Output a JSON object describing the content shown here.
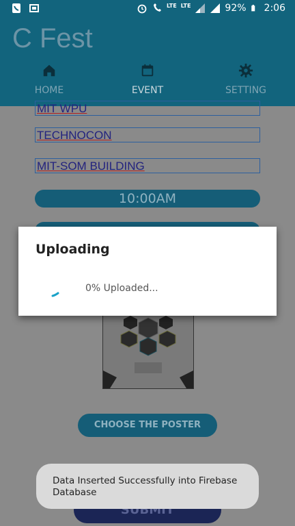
{
  "statusbar": {
    "left_icons": [
      "phone-icon",
      "gallery-icon"
    ],
    "right_icons": [
      "alarm-icon",
      "volte-icon",
      "lte-icon",
      "signal-icon",
      "signal-icon-2",
      "battery-icon"
    ],
    "lte_text_1": "LTE",
    "lte_text_2": "LTE",
    "battery": "92%",
    "time": "2:06"
  },
  "app": {
    "title": "C Fest",
    "tabs": [
      {
        "label": "HOME",
        "icon": "home-icon"
      },
      {
        "label": "EVENT",
        "icon": "calendar-icon"
      },
      {
        "label": "SETTING",
        "icon": "gear-icon"
      }
    ]
  },
  "form": {
    "field_partial": "MIT WPU",
    "event_name": "TECHNOCON",
    "venue": "MIT-SOM BUILDING",
    "time": "10:00AM",
    "choose_poster": "CHOOSE THE POSTER",
    "submit": "SUBMIT"
  },
  "dialog": {
    "title": "Uploading",
    "message": "0% Uploaded..."
  },
  "toast": {
    "message": "Data Inserted Successfully into Firebase Database"
  }
}
